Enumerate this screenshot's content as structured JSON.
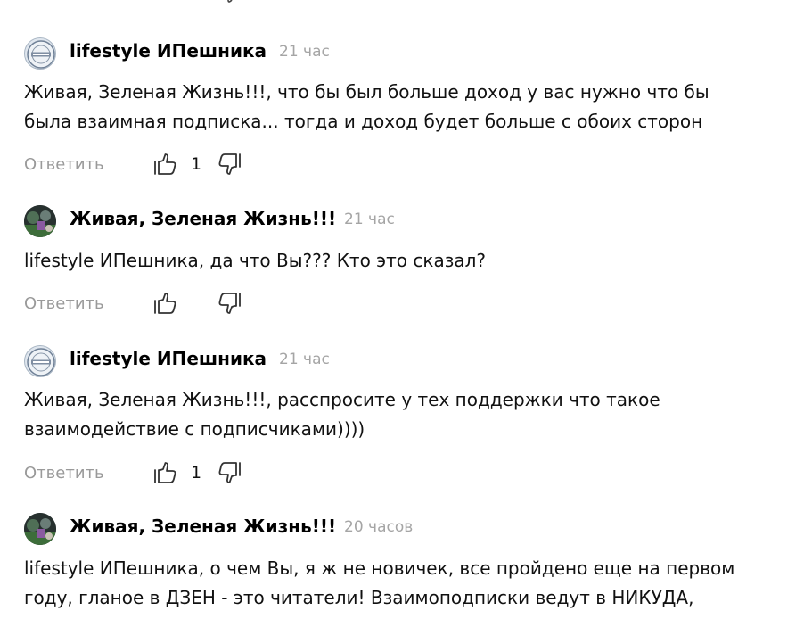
{
  "comments": [
    {
      "author": "lifestyle ИПешника",
      "time": "21 час",
      "text": "Живая, Зеленая Жизнь!!!, что бы был больше доход у вас нужно что бы\nбыла взаимная подписка... тогда и доход будет больше с обоих сторон",
      "reply_label": "Ответить",
      "likes": "1",
      "avatar": "logo"
    },
    {
      "author": "Живая, Зеленая Жизнь!!!",
      "time": "21 час",
      "text": "lifestyle ИПешника, да что Вы??? Кто это сказал?",
      "reply_label": "Ответить",
      "likes": "",
      "avatar": "photo"
    },
    {
      "author": "lifestyle ИПешника",
      "time": "21 час",
      "text": "Живая, Зеленая Жизнь!!!, расспросите у тех поддержки что такое\nвзаимодействие с подписчиками))))",
      "reply_label": "Ответить",
      "likes": "1",
      "avatar": "logo"
    },
    {
      "author": "Живая, Зеленая Жизнь!!!",
      "time": "20 часов",
      "text": "lifestyle ИПешника, о чем Вы, я ж не новичек, все пройдено еще на первом\nгоду, гланое в ДЗЕН - это читатели! Взаимоподписки ведут в НИКУДА,",
      "avatar": "photo"
    }
  ],
  "icons": {
    "like": "thumbs-up-icon",
    "dislike": "thumbs-down-icon"
  },
  "colors": {
    "muted": "#9a9a9a",
    "time": "#a5a5a5",
    "text": "#111111"
  }
}
